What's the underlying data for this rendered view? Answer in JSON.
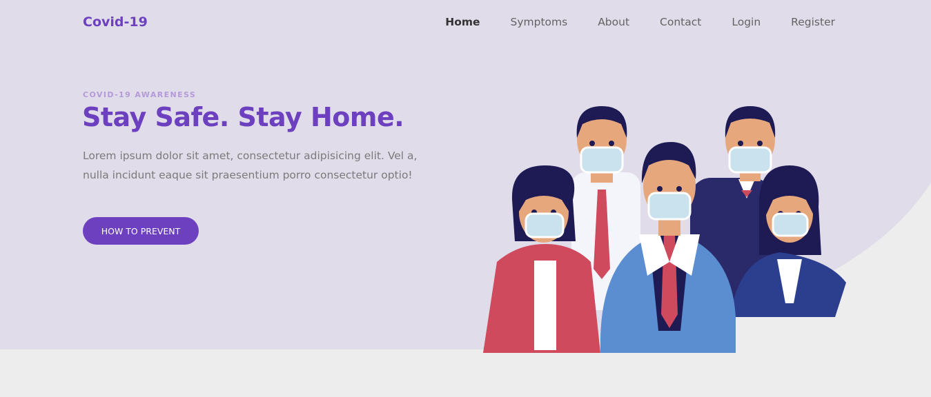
{
  "colors": {
    "brand": "#6c40be",
    "hero_bg": "#e0dcea",
    "page_bg": "#ededed",
    "eyebrow": "#b49ad8"
  },
  "header": {
    "brand": "Covid-19",
    "nav": [
      {
        "label": "Home",
        "active": true
      },
      {
        "label": "Symptoms",
        "active": false
      },
      {
        "label": "About",
        "active": false
      },
      {
        "label": "Contact",
        "active": false
      },
      {
        "label": "Login",
        "active": false
      },
      {
        "label": "Register",
        "active": false
      }
    ]
  },
  "hero": {
    "eyebrow": "COVID-19 AWARENESS",
    "title": "Stay Safe. Stay Home.",
    "text": "Lorem ipsum dolor sit amet, consectetur adipisicing elit. Vel a, nulla incidunt eaque sit praesentium porro consectetur optio!",
    "cta": "HOW TO PREVENT"
  }
}
